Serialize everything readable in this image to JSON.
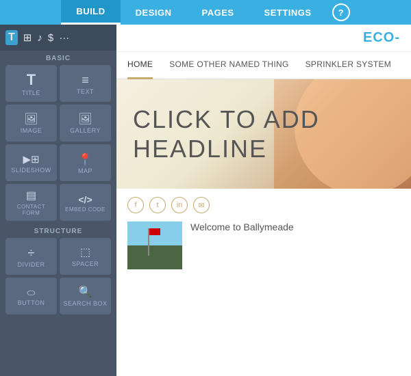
{
  "topNav": {
    "items": [
      {
        "label": "BUILD",
        "active": true
      },
      {
        "label": "DESIGN",
        "active": false
      },
      {
        "label": "PAGES",
        "active": false
      },
      {
        "label": "SETTINGS",
        "active": false
      }
    ],
    "helpLabel": "?"
  },
  "sidebar": {
    "tools": [
      "T",
      "▦",
      "♪",
      "$",
      "···"
    ],
    "sections": [
      {
        "label": "BASIC",
        "widgets": [
          {
            "icon": "T",
            "label": "TITLE"
          },
          {
            "icon": "≡",
            "label": "TEXT"
          },
          {
            "icon": "🖼",
            "label": "IMAGE"
          },
          {
            "icon": "🖼",
            "label": "GALLERY"
          },
          {
            "icon": "▶",
            "label": "SLIDESHOW"
          },
          {
            "icon": "📍",
            "label": "MAP"
          },
          {
            "icon": "▤",
            "label": "CONTACT FORM"
          },
          {
            "icon": "</>",
            "label": "EMBED CODE"
          }
        ]
      },
      {
        "label": "STRUCTURE",
        "widgets": [
          {
            "icon": "÷",
            "label": "DIVIDER"
          },
          {
            "icon": "⬚",
            "label": "SPACER"
          },
          {
            "icon": "⬭",
            "label": "BUTTON"
          },
          {
            "icon": "🔍",
            "label": "SEARCH BOX"
          }
        ]
      }
    ]
  },
  "sitePreview": {
    "logoText": "ECO-",
    "nav": {
      "items": [
        {
          "label": "HOME",
          "active": true
        },
        {
          "label": "SOME OTHER NAMED THING",
          "active": false
        },
        {
          "label": "SPRINKLER SYSTEM",
          "active": false
        }
      ]
    },
    "hero": {
      "headlineText": "CLICK TO ADD HEADLINE"
    },
    "social": {
      "icons": [
        "f",
        "t",
        "in",
        "✉"
      ]
    },
    "welcome": {
      "title": "Welcome to Ballymeade"
    }
  }
}
